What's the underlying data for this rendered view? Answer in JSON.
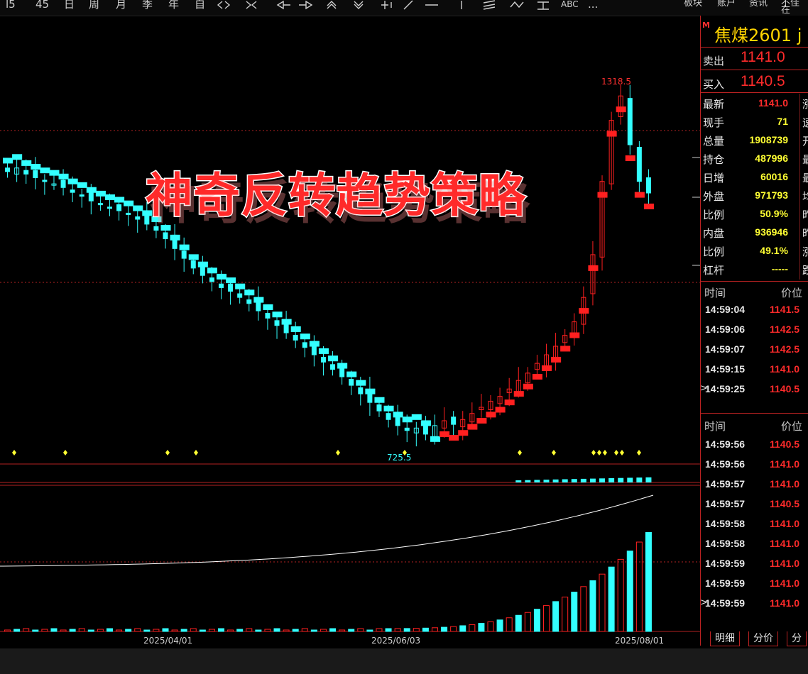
{
  "toolbar": {
    "items": [
      "l5",
      "45",
      "日",
      "周",
      "月",
      "季",
      "年",
      "自",
      "",
      "",
      "",
      "",
      "",
      "",
      "",
      "",
      "",
      "",
      "",
      "ABC",
      "..."
    ],
    "right_items": [
      "板块",
      "账户",
      "资讯",
      "不佳在"
    ]
  },
  "symbol": {
    "name": "焦煤2601",
    "suffix": "j",
    "m_mark": "M"
  },
  "quote": {
    "sell_label": "卖出",
    "sell_value": "1141.0",
    "buy_label": "买入",
    "buy_value": "1140.5"
  },
  "stats": [
    {
      "label": "最新",
      "value": "1141.0",
      "color": "#ff2b2b",
      "extra": "涨"
    },
    {
      "label": "现手",
      "value": "71",
      "color": "#ffff33",
      "extra": "速"
    },
    {
      "label": "总量",
      "value": "1908739",
      "color": "#ffff33",
      "extra": "开"
    },
    {
      "label": "持仓",
      "value": "487996",
      "color": "#ffff33",
      "extra": "最"
    },
    {
      "label": "日增",
      "value": "60016",
      "color": "#ffff33",
      "extra": "最"
    },
    {
      "label": "外盘",
      "value": "971793",
      "color": "#ffff33",
      "extra": "均"
    },
    {
      "label": "比例",
      "value": "50.9%",
      "color": "#ffff33",
      "extra": "昨"
    },
    {
      "label": "内盘",
      "value": "936946",
      "color": "#ffff33",
      "extra": "昨"
    },
    {
      "label": "比例",
      "value": "49.1%",
      "color": "#ffff33",
      "extra": "涨"
    },
    {
      "label": "杠杆",
      "value": "-----",
      "color": "#ffff33",
      "extra": "跌"
    }
  ],
  "ticks1": {
    "time_header": "时间",
    "price_header": "价位",
    "rows": [
      {
        "time": "14:59:04",
        "price": "1141.5"
      },
      {
        "time": "14:59:06",
        "price": "1142.5"
      },
      {
        "time": "14:59:07",
        "price": "1142.5"
      },
      {
        "time": "14:59:15",
        "price": "1141.0"
      },
      {
        "time": "14:59:25",
        "price": "1140.5",
        "marker": ">"
      }
    ]
  },
  "ticks2": {
    "time_header": "时间",
    "price_header": "价位",
    "rows": [
      {
        "time": "14:59:56",
        "price": "1140.5"
      },
      {
        "time": "14:59:56",
        "price": "1141.0"
      },
      {
        "time": "14:59:57",
        "price": "1141.0"
      },
      {
        "time": "14:59:57",
        "price": "1140.5"
      },
      {
        "time": "14:59:58",
        "price": "1141.0"
      },
      {
        "time": "14:59:58",
        "price": "1141.0"
      },
      {
        "time": "14:59:59",
        "price": "1141.0"
      },
      {
        "time": "14:59:59",
        "price": "1141.0"
      },
      {
        "time": "14:59:59",
        "price": "1141.0",
        "marker": ">"
      }
    ]
  },
  "tabs": [
    "明细",
    "分价",
    "分"
  ],
  "dates": [
    "2025/04/01",
    "2025/06/03",
    "2025/08/01"
  ],
  "annotations": {
    "high": "1318.5",
    "low": "725.5"
  },
  "overlay_title": "神奇反转趋势策略",
  "chart_data": {
    "type": "candlestick",
    "title": "焦煤2601",
    "x_labels": [
      "2025/04/01",
      "2025/06/03",
      "2025/08/01"
    ],
    "high_annotation": 1318.5,
    "low_annotation": 725.5,
    "close_series": [
      1176,
      1182,
      1172,
      1166,
      1160,
      1156,
      1150,
      1142,
      1136,
      1128,
      1122,
      1116,
      1112,
      1106,
      1098,
      1090,
      1080,
      1066,
      1050,
      1034,
      1018,
      1006,
      996,
      986,
      980,
      970,
      960,
      948,
      936,
      924,
      912,
      900,
      888,
      876,
      864,
      852,
      840,
      826,
      812,
      798,
      784,
      770,
      760,
      752,
      756,
      746,
      760,
      768,
      762,
      770,
      780,
      790,
      800,
      808,
      820,
      834,
      846,
      862,
      876,
      890,
      908,
      930,
      970,
      1040,
      1160,
      1260,
      1300,
      1220,
      1160,
      1141
    ],
    "colors": {
      "up": "#ff2020",
      "down": "#33ffff",
      "grid": "#b22222",
      "volume_line": "#ffffff"
    }
  }
}
